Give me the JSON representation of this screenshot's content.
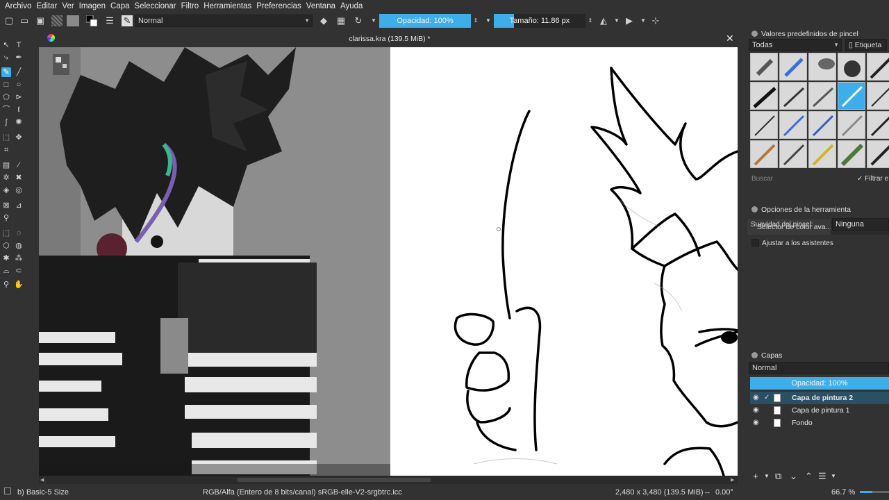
{
  "menu": [
    "Archivo",
    "Editar",
    "Ver",
    "Imagen",
    "Capa",
    "Seleccionar",
    "Filtro",
    "Herramientas",
    "Preferencias",
    "Ventana",
    "Ayuda"
  ],
  "toolbar": {
    "blend_mode": "Normal",
    "opacity_label": "Opacidad: 100%",
    "size_label": "Tamaño: 11.86 px"
  },
  "document": {
    "title": "clarissa.kra (139.5 MiB) *",
    "close_glyph": "✕"
  },
  "presets": {
    "title": "Valores predefinidos de pincel",
    "filter_select": "Todas",
    "tag_button": "Etiqueta",
    "search_placeholder": "Buscar",
    "filter_check_label": "Filtrar e"
  },
  "tool_options": {
    "tab_color": "Selector de color ava...",
    "tab_options": "Opciones de la h",
    "title": "Opciones de la herramienta",
    "smoothing_label": "Suavidad del pincel:",
    "smoothing_value": "Ninguna",
    "assistants_label": "Ajustar a los asistentes"
  },
  "layers": {
    "title": "Capas",
    "blend_mode": "Normal",
    "opacity_label": "Opacidad:  100%",
    "items": [
      {
        "name": "Capa de pintura 2",
        "selected": true
      },
      {
        "name": "Capa de pintura 1",
        "selected": false
      },
      {
        "name": "Fondo",
        "selected": false
      }
    ]
  },
  "status": {
    "brush": "b) Basic-5 Size",
    "color_space": "RGB/Alfa (Entero de 8 bits/canal)  sRGB-elle-V2-srgbtrc.icc",
    "dimensions": "2,480 x 3,480 (139.5 MiB)",
    "rotation": "0.00°",
    "zoom": "66.7 %"
  },
  "colors": {
    "accent": "#3daee9",
    "background": "#323232",
    "canvas": "#ffffff"
  }
}
